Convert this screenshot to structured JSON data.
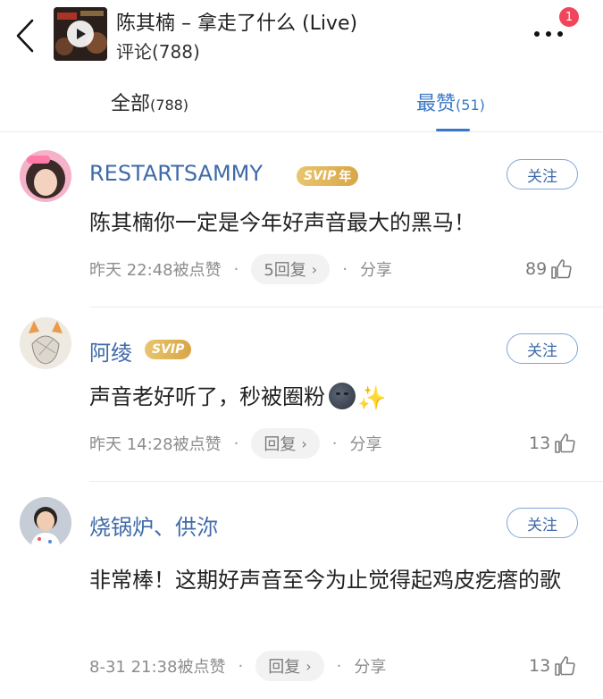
{
  "header": {
    "title": "陈其楠 – 拿走了什么 (Live)",
    "subtitle": "评论(788)",
    "notification_count": "1"
  },
  "tabs": [
    {
      "label": "全部",
      "count": "(788)",
      "active": false
    },
    {
      "label": "最赞",
      "count": "(51)",
      "active": true
    }
  ],
  "colors": {
    "accent": "#3978c7",
    "username": "#3f6aa8",
    "badge": "#f2445a",
    "svip": "#dcae50"
  },
  "comments": [
    {
      "username": "RESTARTSAMMY",
      "vip_label": "SVIP",
      "vip_suffix": "年",
      "follow_label": "关注",
      "text": "陈其楠你一定是今年好声音最大的黑马！",
      "time": "昨天 22:48被点赞",
      "reply_label": "5回复",
      "share_label": "分享",
      "likes": "89",
      "avatar_icon": "portrait-avatar-pink-frame"
    },
    {
      "username": "阿绫",
      "vip_label": "SVIP",
      "follow_label": "关注",
      "text": "声音老好听了，秒被圈粉",
      "emoji": [
        "new-moon-face-emoji",
        "sparkles-emoji"
      ],
      "time": "昨天 14:28被点赞",
      "reply_label": "回复",
      "share_label": "分享",
      "likes": "13",
      "avatar_icon": "sketch-avatar-cat-ears"
    },
    {
      "username": "烧锅炉、供沵",
      "follow_label": "关注",
      "text": "非常棒！这期好声音至今为止觉得起鸡皮疙瘩的歌",
      "time": "8-31 21:38被点赞",
      "reply_label": "回复",
      "share_label": "分享",
      "likes": "13",
      "avatar_icon": "child-photo-avatar"
    }
  ],
  "icons": {
    "back": "chevron-left-icon",
    "play": "play-icon",
    "more": "more-dots-icon",
    "like": "thumbs-up-icon",
    "reply_chevron": "chevron-right-icon"
  }
}
